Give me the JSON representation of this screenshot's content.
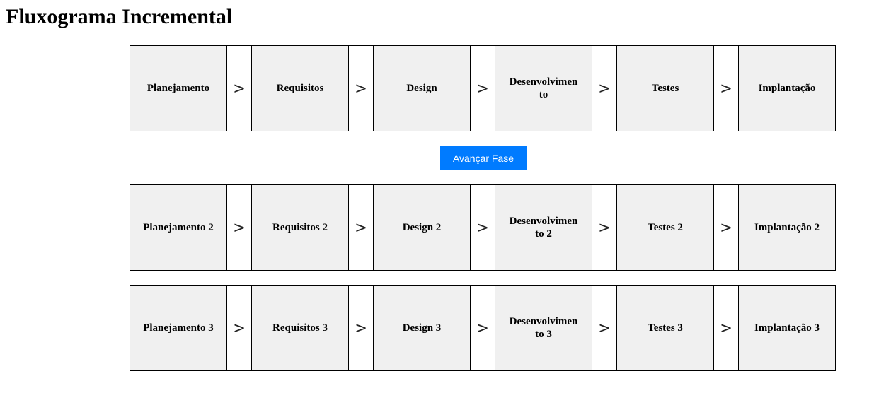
{
  "title": "Fluxograma Incremental",
  "arrow_symbol": ">",
  "button_label": "Avançar Fase",
  "button_color": "#007bff",
  "step_background": "#f0f0f0",
  "flows": [
    {
      "steps": [
        "Planejamento",
        "Requisitos",
        "Design",
        "Desenvolvimento",
        "Testes",
        "Implantação"
      ]
    },
    {
      "steps": [
        "Planejamento 2",
        "Requisitos 2",
        "Design 2",
        "Desenvolvimento 2",
        "Testes 2",
        "Implantação 2"
      ]
    },
    {
      "steps": [
        "Planejamento 3",
        "Requisitos 3",
        "Design 3",
        "Desenvolvimento 3",
        "Testes 3",
        "Implantação 3"
      ]
    }
  ]
}
